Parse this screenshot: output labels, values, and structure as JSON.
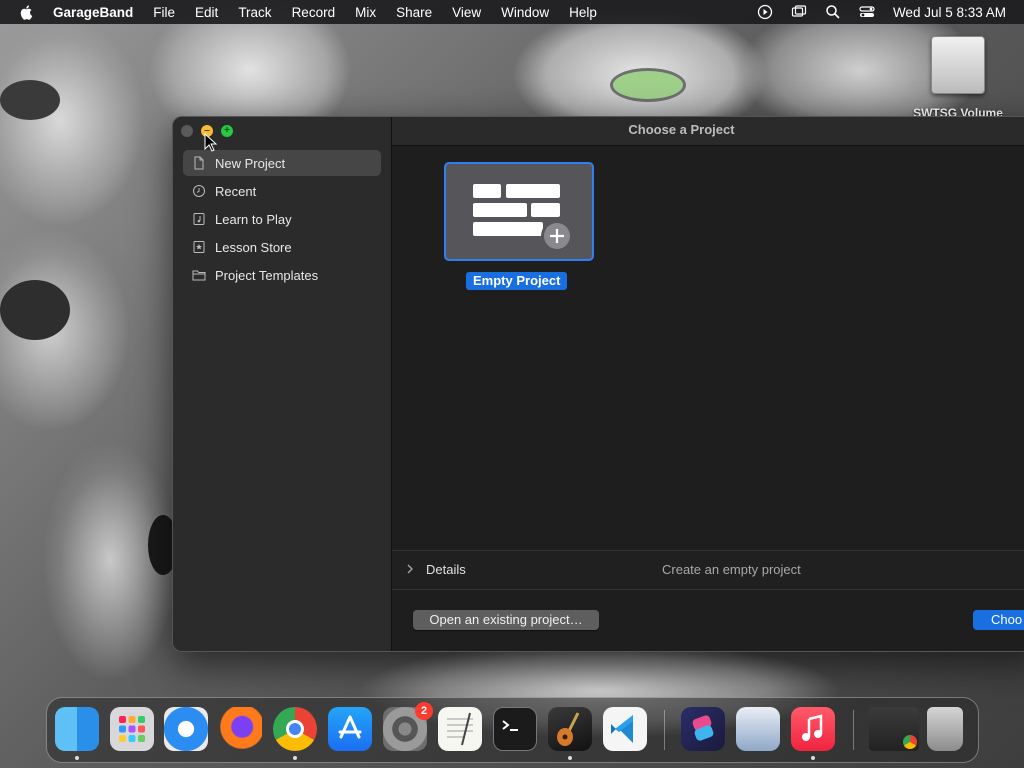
{
  "menubar": {
    "app_name": "GarageBand",
    "items": [
      "File",
      "Edit",
      "Track",
      "Record",
      "Mix",
      "Share",
      "View",
      "Window",
      "Help"
    ],
    "clock": "Wed Jul 5  8:33 AM"
  },
  "desktop": {
    "volume_label": "SWTSG Volume"
  },
  "window": {
    "title": "Choose a Project",
    "sidebar": {
      "items": [
        {
          "label": "New Project",
          "icon": "document-icon"
        },
        {
          "label": "Recent",
          "icon": "clock-icon"
        },
        {
          "label": "Learn to Play",
          "icon": "music-note-icon"
        },
        {
          "label": "Lesson Store",
          "icon": "star-icon"
        },
        {
          "label": "Project Templates",
          "icon": "folder-icon"
        }
      ],
      "selected_index": 0
    },
    "project": {
      "label": "Empty Project"
    },
    "details": {
      "label": "Details",
      "description": "Create an empty project"
    },
    "buttons": {
      "open_existing": "Open an existing project…",
      "choose": "Choo"
    }
  },
  "dock": {
    "apps": [
      "Finder",
      "Launchpad",
      "Safari",
      "Firefox",
      "Chrome",
      "App Store",
      "System Settings",
      "TextEdit",
      "Terminal",
      "GarageBand",
      "VS Code",
      "Shortcuts",
      "Preview",
      "Music",
      "Downloads",
      "Trash"
    ],
    "settings_badge": "2"
  },
  "colors": {
    "accent": "#1a6fe0",
    "menubar": "#1c1c1e",
    "window_bg": "#1e1e1e",
    "sidebar_bg": "#2b2b2c"
  }
}
